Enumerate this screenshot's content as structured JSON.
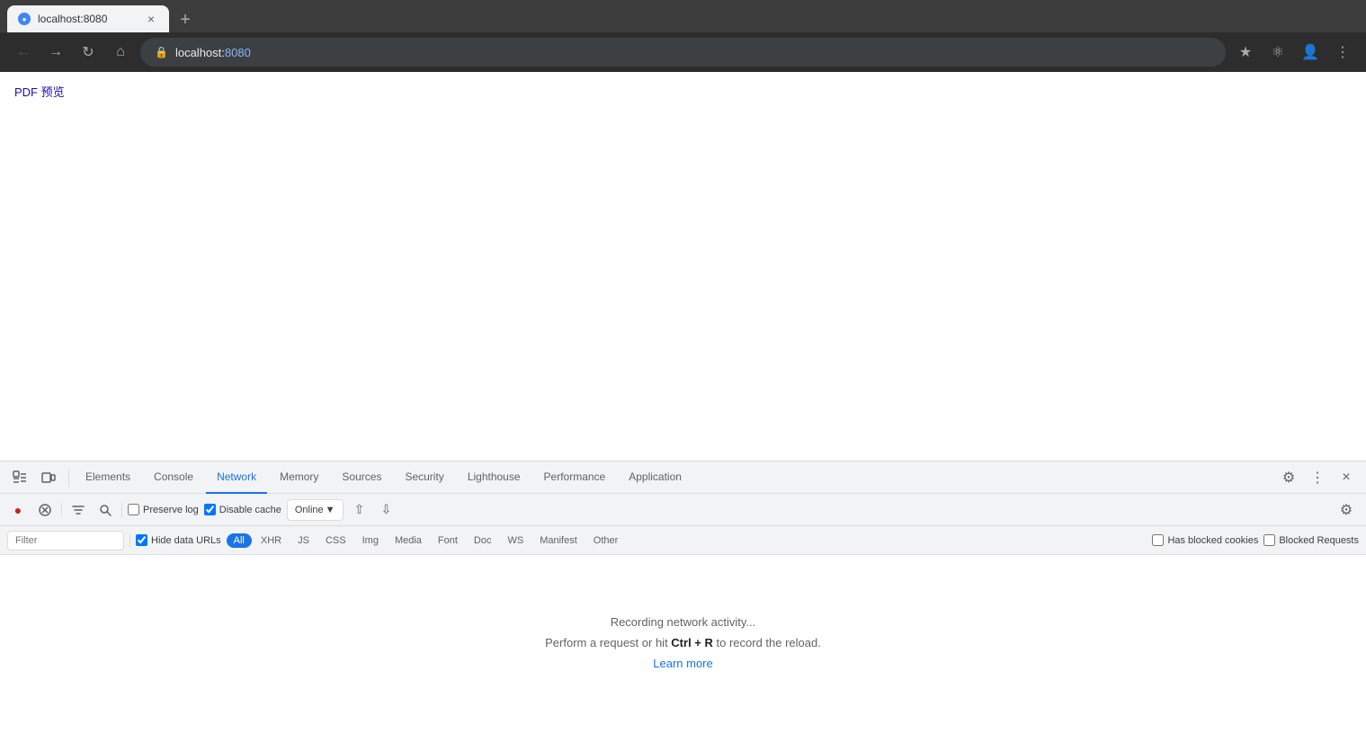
{
  "browser": {
    "tab": {
      "favicon": "●",
      "title": "localhost:8080",
      "close": "×"
    },
    "new_tab": "+",
    "address": {
      "url_prefix": "localhost:",
      "url_highlight": "8080",
      "full_url": "localhost:8080"
    },
    "nav": {
      "back": "←",
      "forward": "→",
      "refresh": "↻",
      "home": "⌂"
    }
  },
  "page": {
    "link_text": "PDF 预览"
  },
  "devtools": {
    "tabs": {
      "elements": "Elements",
      "console": "Console",
      "network": "Network",
      "memory": "Memory",
      "sources": "Sources",
      "security": "Security",
      "lighthouse": "Lighthouse",
      "performance": "Performance",
      "application": "Application"
    },
    "toolbar": {
      "preserve_log_label": "Preserve log",
      "disable_cache_label": "Disable cache",
      "online_label": "Online",
      "preserve_log_checked": false,
      "disable_cache_checked": true
    },
    "filter": {
      "placeholder": "Filter",
      "hide_data_urls_label": "Hide data URLs",
      "hide_data_urls_checked": true,
      "types": [
        "All",
        "XHR",
        "JS",
        "CSS",
        "Img",
        "Media",
        "Font",
        "Doc",
        "WS",
        "Manifest",
        "Other"
      ],
      "active_type": "All",
      "has_blocked_cookies_label": "Has blocked cookies",
      "blocked_requests_label": "Blocked Requests"
    },
    "content": {
      "recording_text": "Recording network activity...",
      "perform_text_prefix": "Perform a request or hit ",
      "perform_shortcut": "Ctrl + R",
      "perform_text_suffix": " to record the reload.",
      "learn_more": "Learn more"
    }
  }
}
